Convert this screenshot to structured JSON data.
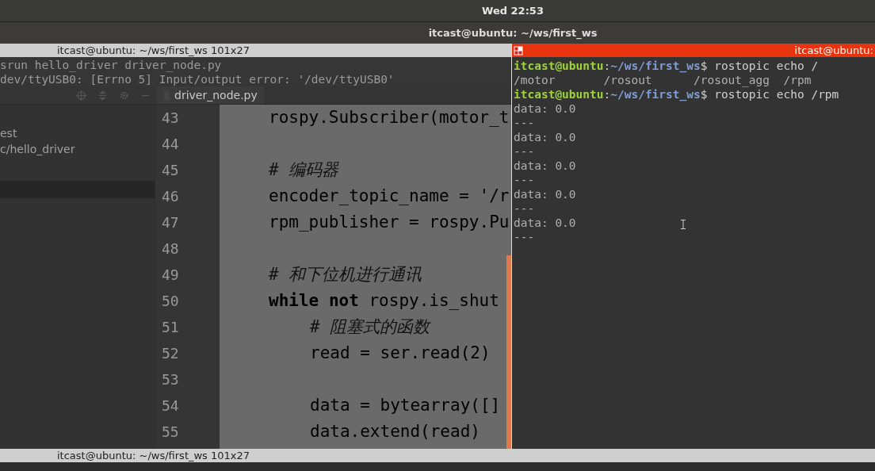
{
  "top_bar": {
    "clock": "Wed 22:53"
  },
  "window": {
    "title": "itcast@ubuntu: ~/ws/first_ws"
  },
  "left_terminal": {
    "title": "itcast@ubuntu: ~/ws/first_ws 101x27",
    "lines": [
      "srun hello_driver driver_node.py",
      "dev/ttyUSB0: [Errno 5] Input/output error: '/dev/ttyUSB0'"
    ]
  },
  "editor": {
    "tab": {
      "label": "driver_node.py"
    },
    "sidebar": {
      "items": [
        {
          "label": "est"
        },
        {
          "label": "c/hello_driver"
        }
      ]
    },
    "code": [
      {
        "number": "43",
        "kind": "code",
        "indent": false,
        "text": "rospy.Subscriber(motor_t"
      },
      {
        "number": "44",
        "kind": "blank"
      },
      {
        "number": "45",
        "kind": "comment",
        "indent": false,
        "text": "# 编码器"
      },
      {
        "number": "46",
        "kind": "code",
        "indent": false,
        "text": "encoder_topic_name = '/r"
      },
      {
        "number": "47",
        "kind": "code",
        "indent": false,
        "text": "rpm_publisher = rospy.Pu"
      },
      {
        "number": "48",
        "kind": "blank"
      },
      {
        "number": "49",
        "kind": "comment",
        "indent": false,
        "text": "# 和下位机进行通讯"
      },
      {
        "number": "50",
        "kind": "code",
        "indent": false,
        "text": "**while** **not** rospy.is_shut"
      },
      {
        "number": "51",
        "kind": "comment",
        "indent": true,
        "text": "# 阻塞式的函数"
      },
      {
        "number": "52",
        "kind": "code",
        "indent": true,
        "text": "read = ser.read(2)"
      },
      {
        "number": "53",
        "kind": "blank"
      },
      {
        "number": "54",
        "kind": "code",
        "indent": true,
        "text": "data = bytearray([]"
      },
      {
        "number": "55",
        "kind": "code",
        "indent": true,
        "text": "data.extend(read)"
      }
    ]
  },
  "right_terminal": {
    "title": "itcast@ubuntu:",
    "lines": [
      {
        "kind": "prompt",
        "user": "itcast@ubuntu",
        "path": ":~/ws/first_ws$",
        "command": " rostopic echo /"
      },
      {
        "kind": "output",
        "text": "/motor       /rosout      /rosout_agg  /rpm"
      },
      {
        "kind": "prompt",
        "user": "itcast@ubuntu",
        "path": ":~/ws/first_ws$",
        "command": " rostopic echo /rpm"
      },
      {
        "kind": "output",
        "text": "data: 0.0"
      },
      {
        "kind": "output",
        "text": "---"
      },
      {
        "kind": "output",
        "text": "data: 0.0"
      },
      {
        "kind": "output",
        "text": "---"
      },
      {
        "kind": "output",
        "text": "data: 0.0"
      },
      {
        "kind": "output",
        "text": "---"
      },
      {
        "kind": "output",
        "text": "data: 0.0"
      },
      {
        "kind": "output",
        "text": "---"
      },
      {
        "kind": "output",
        "text": "data: 0.0"
      },
      {
        "kind": "output",
        "text": "---"
      }
    ]
  },
  "bottom_terminal": {
    "title": "itcast@ubuntu: ~/ws/first_ws 101x27"
  }
}
